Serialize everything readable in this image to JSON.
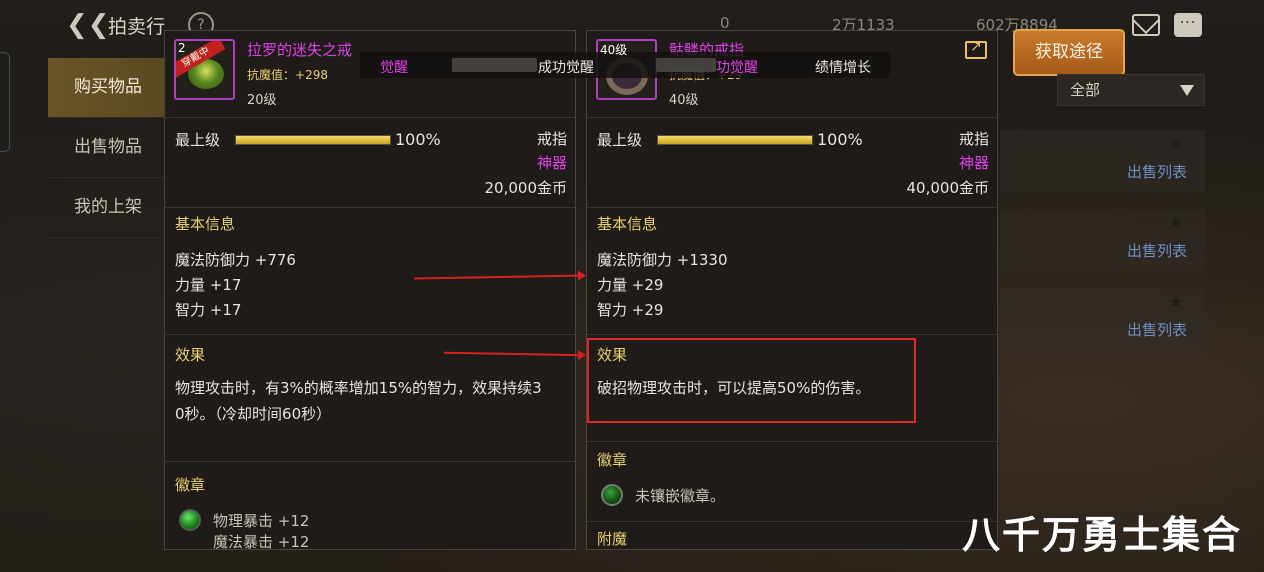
{
  "topbar": {
    "title": "拍卖行",
    "help": "?",
    "currency1": "0",
    "currency2": "2万1133",
    "currency3": "602万8894"
  },
  "nav": {
    "items": [
      {
        "label": "购买物品",
        "active": true
      },
      {
        "label": "出售物品",
        "active": false
      },
      {
        "label": "我的上架",
        "active": false
      }
    ]
  },
  "right_controls": {
    "get_path_label": "获取途径",
    "filter_value": "全部",
    "sell_list_labels": [
      "出售列表",
      "出售列表",
      "出售列表"
    ]
  },
  "overlay": {
    "awaken1": "觉醒",
    "text2": "成功觉醒",
    "text3": "功觉醒",
    "text4": "绩情增长"
  },
  "left_item": {
    "icon_level": "2",
    "equipped_tag": "穿戴中",
    "name": "拉罗的迷失之戒",
    "stat_label": "抗魔值：",
    "stat_value": "+298",
    "level": "20级",
    "grade_label": "最上级",
    "grade_pct": "100%",
    "grade_fraction": 1.0,
    "type": "戒指",
    "rarity": "神器",
    "price": "20,000金币",
    "basic_title": "基本信息",
    "stats": [
      "魔法防御力 +776",
      "力量 +17",
      "智力 +17"
    ],
    "effect_title": "效果",
    "effect_text_1": "物理攻击时，有3%的概率增加15%的智力，效果持续3",
    "effect_text_2": "0秒。（冷却时间60秒）",
    "emblem_title": "徽章",
    "emblem_1": "物理暴击 +12",
    "emblem_2": "魔法暴击 +12"
  },
  "right_item": {
    "icon_level": "40级",
    "name": "骷髅的戒指",
    "stat_label": "抗魔值：",
    "stat_value": "+29",
    "level": "40级",
    "grade_label": "最上级",
    "grade_pct": "100%",
    "grade_fraction": 1.0,
    "type": "戒指",
    "rarity": "神器",
    "price": "40,000金币",
    "basic_title": "基本信息",
    "stats": [
      "魔法防御力 +1330",
      "力量 +29",
      "智力 +29"
    ],
    "effect_title": "效果",
    "effect_text": "破招物理攻击时，可以提高50%的伤害。",
    "emblem_title": "徽章",
    "emblem_empty": "未镶嵌徽章。",
    "enchant_title": "附魔"
  },
  "watermark": "八千万勇士集合"
}
